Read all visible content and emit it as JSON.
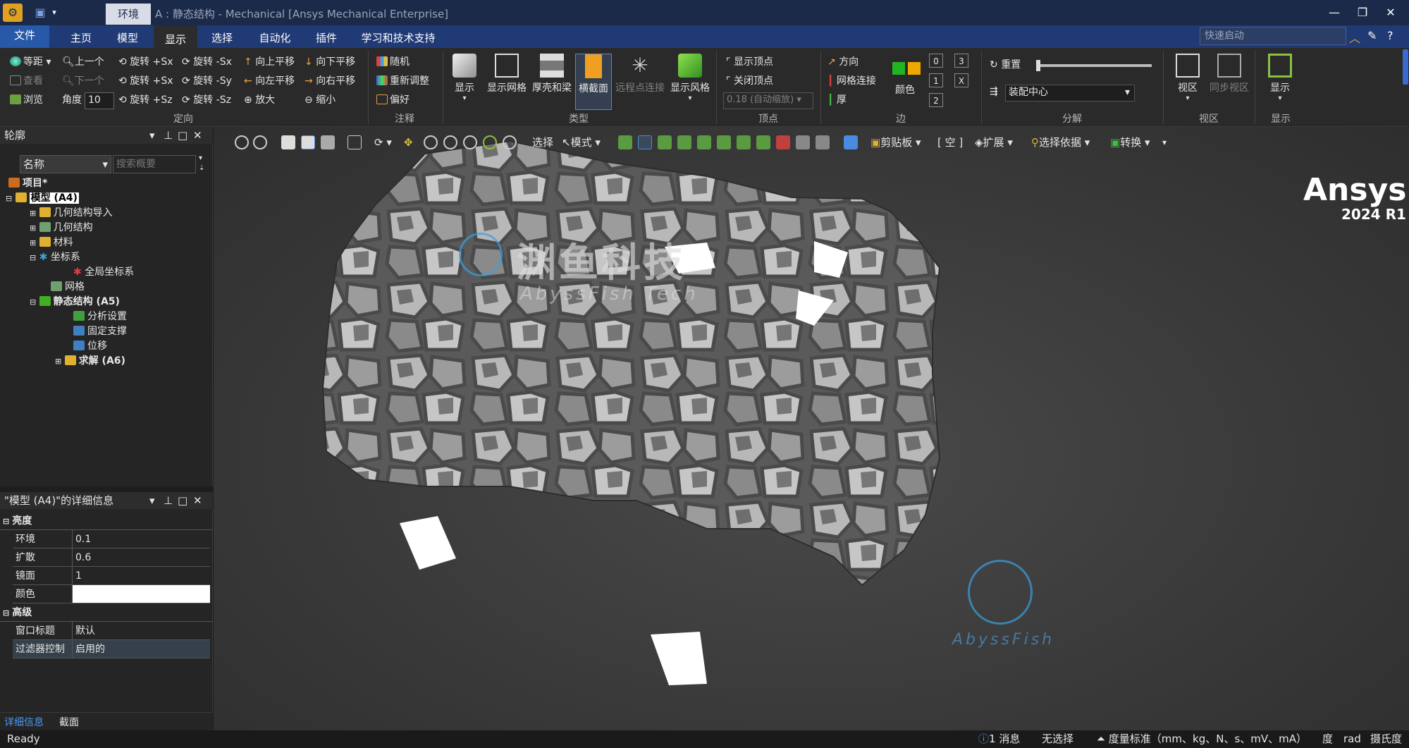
{
  "window": {
    "context_tab": "环境",
    "title": "A : 静态结构 - Mechanical [Ansys Mechanical Enterprise]",
    "minimize": "—",
    "restore": "❐",
    "close": "✕"
  },
  "menubar": {
    "items": [
      "文件",
      "主页",
      "模型",
      "显示",
      "选择",
      "自动化",
      "插件",
      "学习和技术支持"
    ],
    "active": "显示",
    "quick_launch_placeholder": "快速启动"
  },
  "ribbon": {
    "orient": {
      "col1": [
        "等距",
        "查看",
        "浏览"
      ],
      "col2": [
        "上一个",
        "下一个"
      ],
      "angle_label": "角度",
      "angle_value": "10",
      "col3": [
        "旋转 +Sx",
        "旋转 +Sx",
        "旋转 +Sz"
      ],
      "col4": [
        "旋转 -Sx",
        "旋转 -Sy",
        "旋转 -Sz"
      ],
      "col5": [
        "向上平移",
        "向左平移",
        "放大"
      ],
      "col6": [
        "向下平移",
        "向右平移",
        "缩小"
      ],
      "group": "定向"
    },
    "annot": {
      "items": [
        "随机",
        "重新调整",
        "偏好"
      ],
      "group": "注释"
    },
    "type": {
      "items": [
        "显示",
        "显示网格",
        "厚壳和梁",
        "横截面",
        "远程点连接",
        "显示风格"
      ],
      "group": "类型"
    },
    "vertex": {
      "items": [
        "显示顶点",
        "关闭顶点"
      ],
      "scale": "0.18 (自动缩放)",
      "group": "顶点"
    },
    "edge": {
      "items": [
        "方向",
        "网格连接",
        "厚"
      ],
      "color_label": "颜色",
      "nums": [
        "0",
        "1",
        "2",
        "3",
        "X"
      ],
      "group": "边"
    },
    "explode": {
      "reset": "重置",
      "center": "装配中心",
      "group": "分解"
    },
    "viewport": {
      "items": [
        "视区",
        "同步视区"
      ],
      "group": "视区"
    },
    "show": {
      "label": "显示",
      "group": "显示"
    }
  },
  "outline": {
    "title": "轮廓",
    "name_col": "名称",
    "search_placeholder": "搜索概要",
    "tree": [
      {
        "label": "项目*",
        "indent": 0,
        "bold": true
      },
      {
        "label": "模型 (A4)",
        "indent": 1,
        "bold": true
      },
      {
        "label": "几何结构导入",
        "indent": 2,
        "bold": false
      },
      {
        "label": "几何结构",
        "indent": 2,
        "bold": false
      },
      {
        "label": "材料",
        "indent": 2,
        "bold": false
      },
      {
        "label": "坐标系",
        "indent": 2,
        "bold": false
      },
      {
        "label": "全局坐标系",
        "indent": 3,
        "bold": false
      },
      {
        "label": "网格",
        "indent": 2,
        "bold": false
      },
      {
        "label": "静态结构 (A5)",
        "indent": 2,
        "bold": true
      },
      {
        "label": "分析设置",
        "indent": 3,
        "bold": false
      },
      {
        "label": "固定支撑",
        "indent": 3,
        "bold": false
      },
      {
        "label": "位移",
        "indent": 3,
        "bold": false
      },
      {
        "label": "求解 (A6)",
        "indent": 3,
        "bold": true
      }
    ]
  },
  "details": {
    "title": "\"模型 (A4)\"的详细信息",
    "sections": [
      {
        "name": "亮度",
        "rows": [
          [
            "环境",
            "0.1"
          ],
          [
            "扩散",
            "0.6"
          ],
          [
            "镜面",
            "1"
          ],
          [
            "颜色",
            ""
          ]
        ]
      },
      {
        "name": "高级",
        "rows": [
          [
            "窗口标题",
            "默认"
          ],
          [
            "过滤器控制",
            "启用的"
          ]
        ]
      }
    ],
    "tabs": [
      "详细信息",
      "截面"
    ]
  },
  "viewtoolbar": {
    "select": "选择",
    "mode": "模式",
    "clipboard": "剪贴板",
    "empty": "[ 空 ]",
    "extend": "扩展",
    "select_by": "选择依据",
    "convert": "转换"
  },
  "brand": {
    "name": "Ansys",
    "version": "2024 R1"
  },
  "watermark": {
    "cn": "渊鱼科技",
    "en": "AbyssFish Tech",
    "en2": "AbyssFish"
  },
  "status": {
    "ready": "Ready",
    "messages": "1 消息",
    "selection": "无选择",
    "units": "度量标准（mm、kg、N、s、mV、mA）",
    "deg": "度",
    "rad": "rad",
    "temp": "摄氏度"
  },
  "colors": {
    "accent": "#2858a8",
    "titlebar": "#1c2a4a",
    "menubar": "#1f3a75",
    "edge_green": "#22b522",
    "edge_orange": "#f0a800"
  }
}
